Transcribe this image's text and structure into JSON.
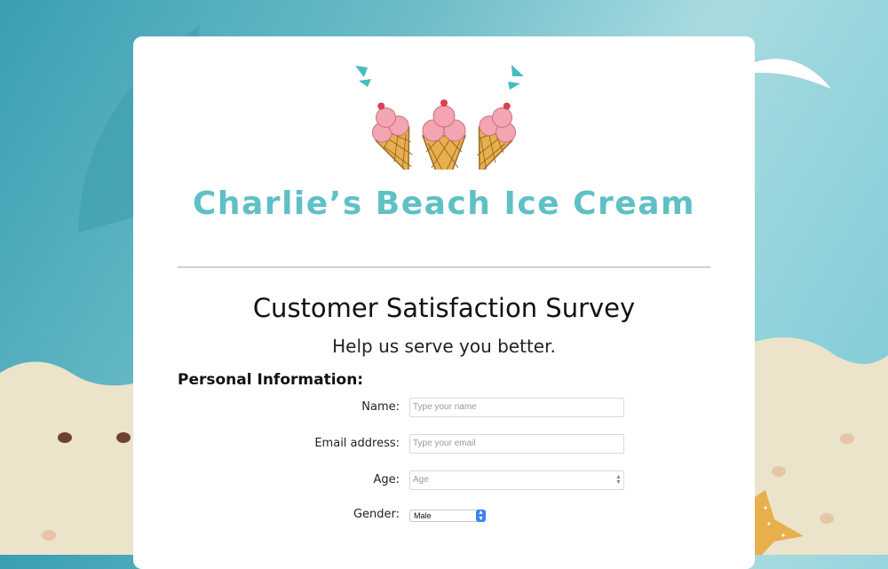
{
  "brand": {
    "name": "Charlie’s Beach Ice Cream"
  },
  "survey": {
    "title": "Customer Satisfaction Survey",
    "subtitle": "Help us serve you better."
  },
  "personal_info": {
    "heading": "Personal Information:",
    "name_label": "Name:",
    "name_placeholder": "Type your name",
    "email_label": "Email address:",
    "email_placeholder": "Type your email",
    "age_label": "Age:",
    "age_placeholder": "Age",
    "gender_label": "Gender:",
    "gender_selected": "Male"
  },
  "colors": {
    "brand": "#5fc0c5",
    "sea": "#4aaabb",
    "sand": "#ece3cb",
    "accent_blue": "#3b82f6"
  },
  "icons": [
    "ice-cream-cones-logo",
    "starfish-icon",
    "shark-fin-icon",
    "spinner-icon",
    "chevron-updown-icon"
  ]
}
